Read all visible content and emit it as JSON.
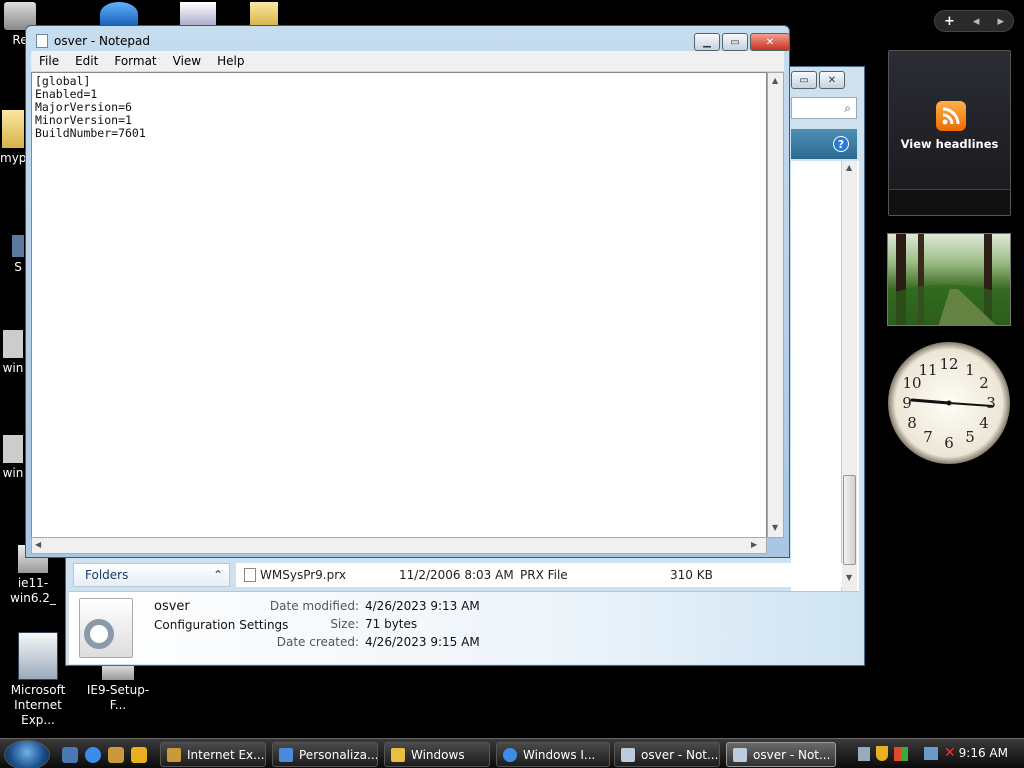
{
  "desktop": {
    "icons": [
      {
        "label": "Re"
      },
      {
        "label": "myp"
      },
      {
        "label": "S"
      },
      {
        "label": "win"
      },
      {
        "label": "win"
      },
      {
        "label": "ie11-win6.2_"
      },
      {
        "label": "Microsoft Internet Exp..."
      },
      {
        "label": "IE9-Setup-F..."
      }
    ]
  },
  "gadgets": {
    "controls": {
      "add": "+",
      "prev": "◂",
      "next": "▸"
    },
    "feed": {
      "label": "View headlines",
      "icon": "rss-icon"
    },
    "slideshow": {
      "icon": "forest-photo"
    },
    "clock": {
      "numbers": [
        "12",
        "1",
        "2",
        "3",
        "4",
        "5",
        "6",
        "7",
        "8",
        "9",
        "10",
        "11"
      ]
    }
  },
  "explorer": {
    "folders_label": "Folders",
    "file_row": {
      "name": "WMSysPr9.prx",
      "date": "11/2/2006 8:03 AM",
      "type": "PRX File",
      "size": "310 KB"
    },
    "details": {
      "name": "osver",
      "type": "Configuration Settings",
      "modified_label": "Date modified:",
      "modified": "4/26/2023 9:13 AM",
      "size_label": "Size:",
      "size": "71 bytes",
      "created_label": "Date created:",
      "created": "4/26/2023 9:15 AM"
    }
  },
  "notepad": {
    "title": "osver - Notepad",
    "menu": [
      "File",
      "Edit",
      "Format",
      "View",
      "Help"
    ],
    "content": "[global]\nEnabled=1\nMajorVersion=6\nMinorVersion=1\nBuildNumber=7601"
  },
  "taskbar": {
    "buttons": [
      {
        "label": "Internet Ex..."
      },
      {
        "label": "Personaliza..."
      },
      {
        "label": "Windows"
      },
      {
        "label": "Windows I..."
      },
      {
        "label": "osver - Not..."
      },
      {
        "label": "osver - Not..."
      }
    ],
    "time": "9:16 AM"
  },
  "colors": {
    "accent": "#2a78d8",
    "taskbar": "#1c1c1c"
  }
}
